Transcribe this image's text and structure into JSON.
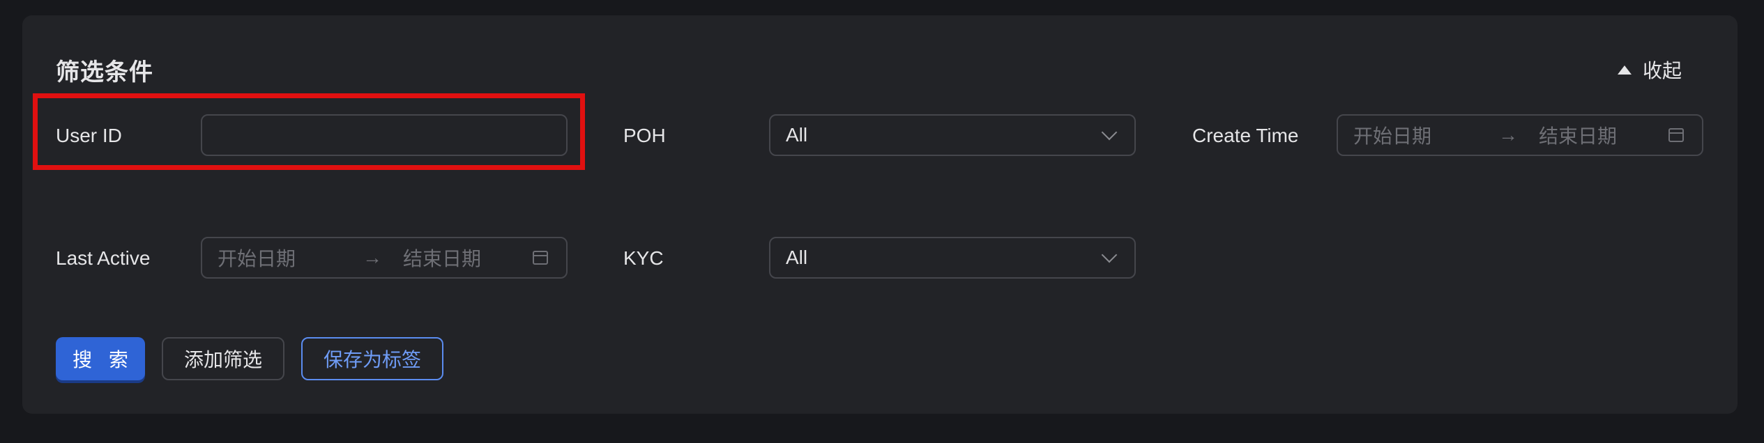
{
  "filter_panel": {
    "title": "筛选条件",
    "collapse_label": "收起",
    "fields": {
      "user_id": {
        "label": "User ID",
        "value": "",
        "placeholder": ""
      },
      "poh": {
        "label": "POH",
        "selected": "All"
      },
      "create_time": {
        "label": "Create Time",
        "start_placeholder": "开始日期",
        "separator": "→",
        "end_placeholder": "结束日期"
      },
      "last_active": {
        "label": "Last Active",
        "start_placeholder": "开始日期",
        "separator": "→",
        "end_placeholder": "结束日期"
      },
      "kyc": {
        "label": "KYC",
        "selected": "All"
      }
    },
    "buttons": {
      "search": "搜 索",
      "add_filter": "添加筛选",
      "save_as_tag": "保存为标签"
    },
    "highlight_color": "#e01010",
    "accent_color": "#2f64d6"
  }
}
